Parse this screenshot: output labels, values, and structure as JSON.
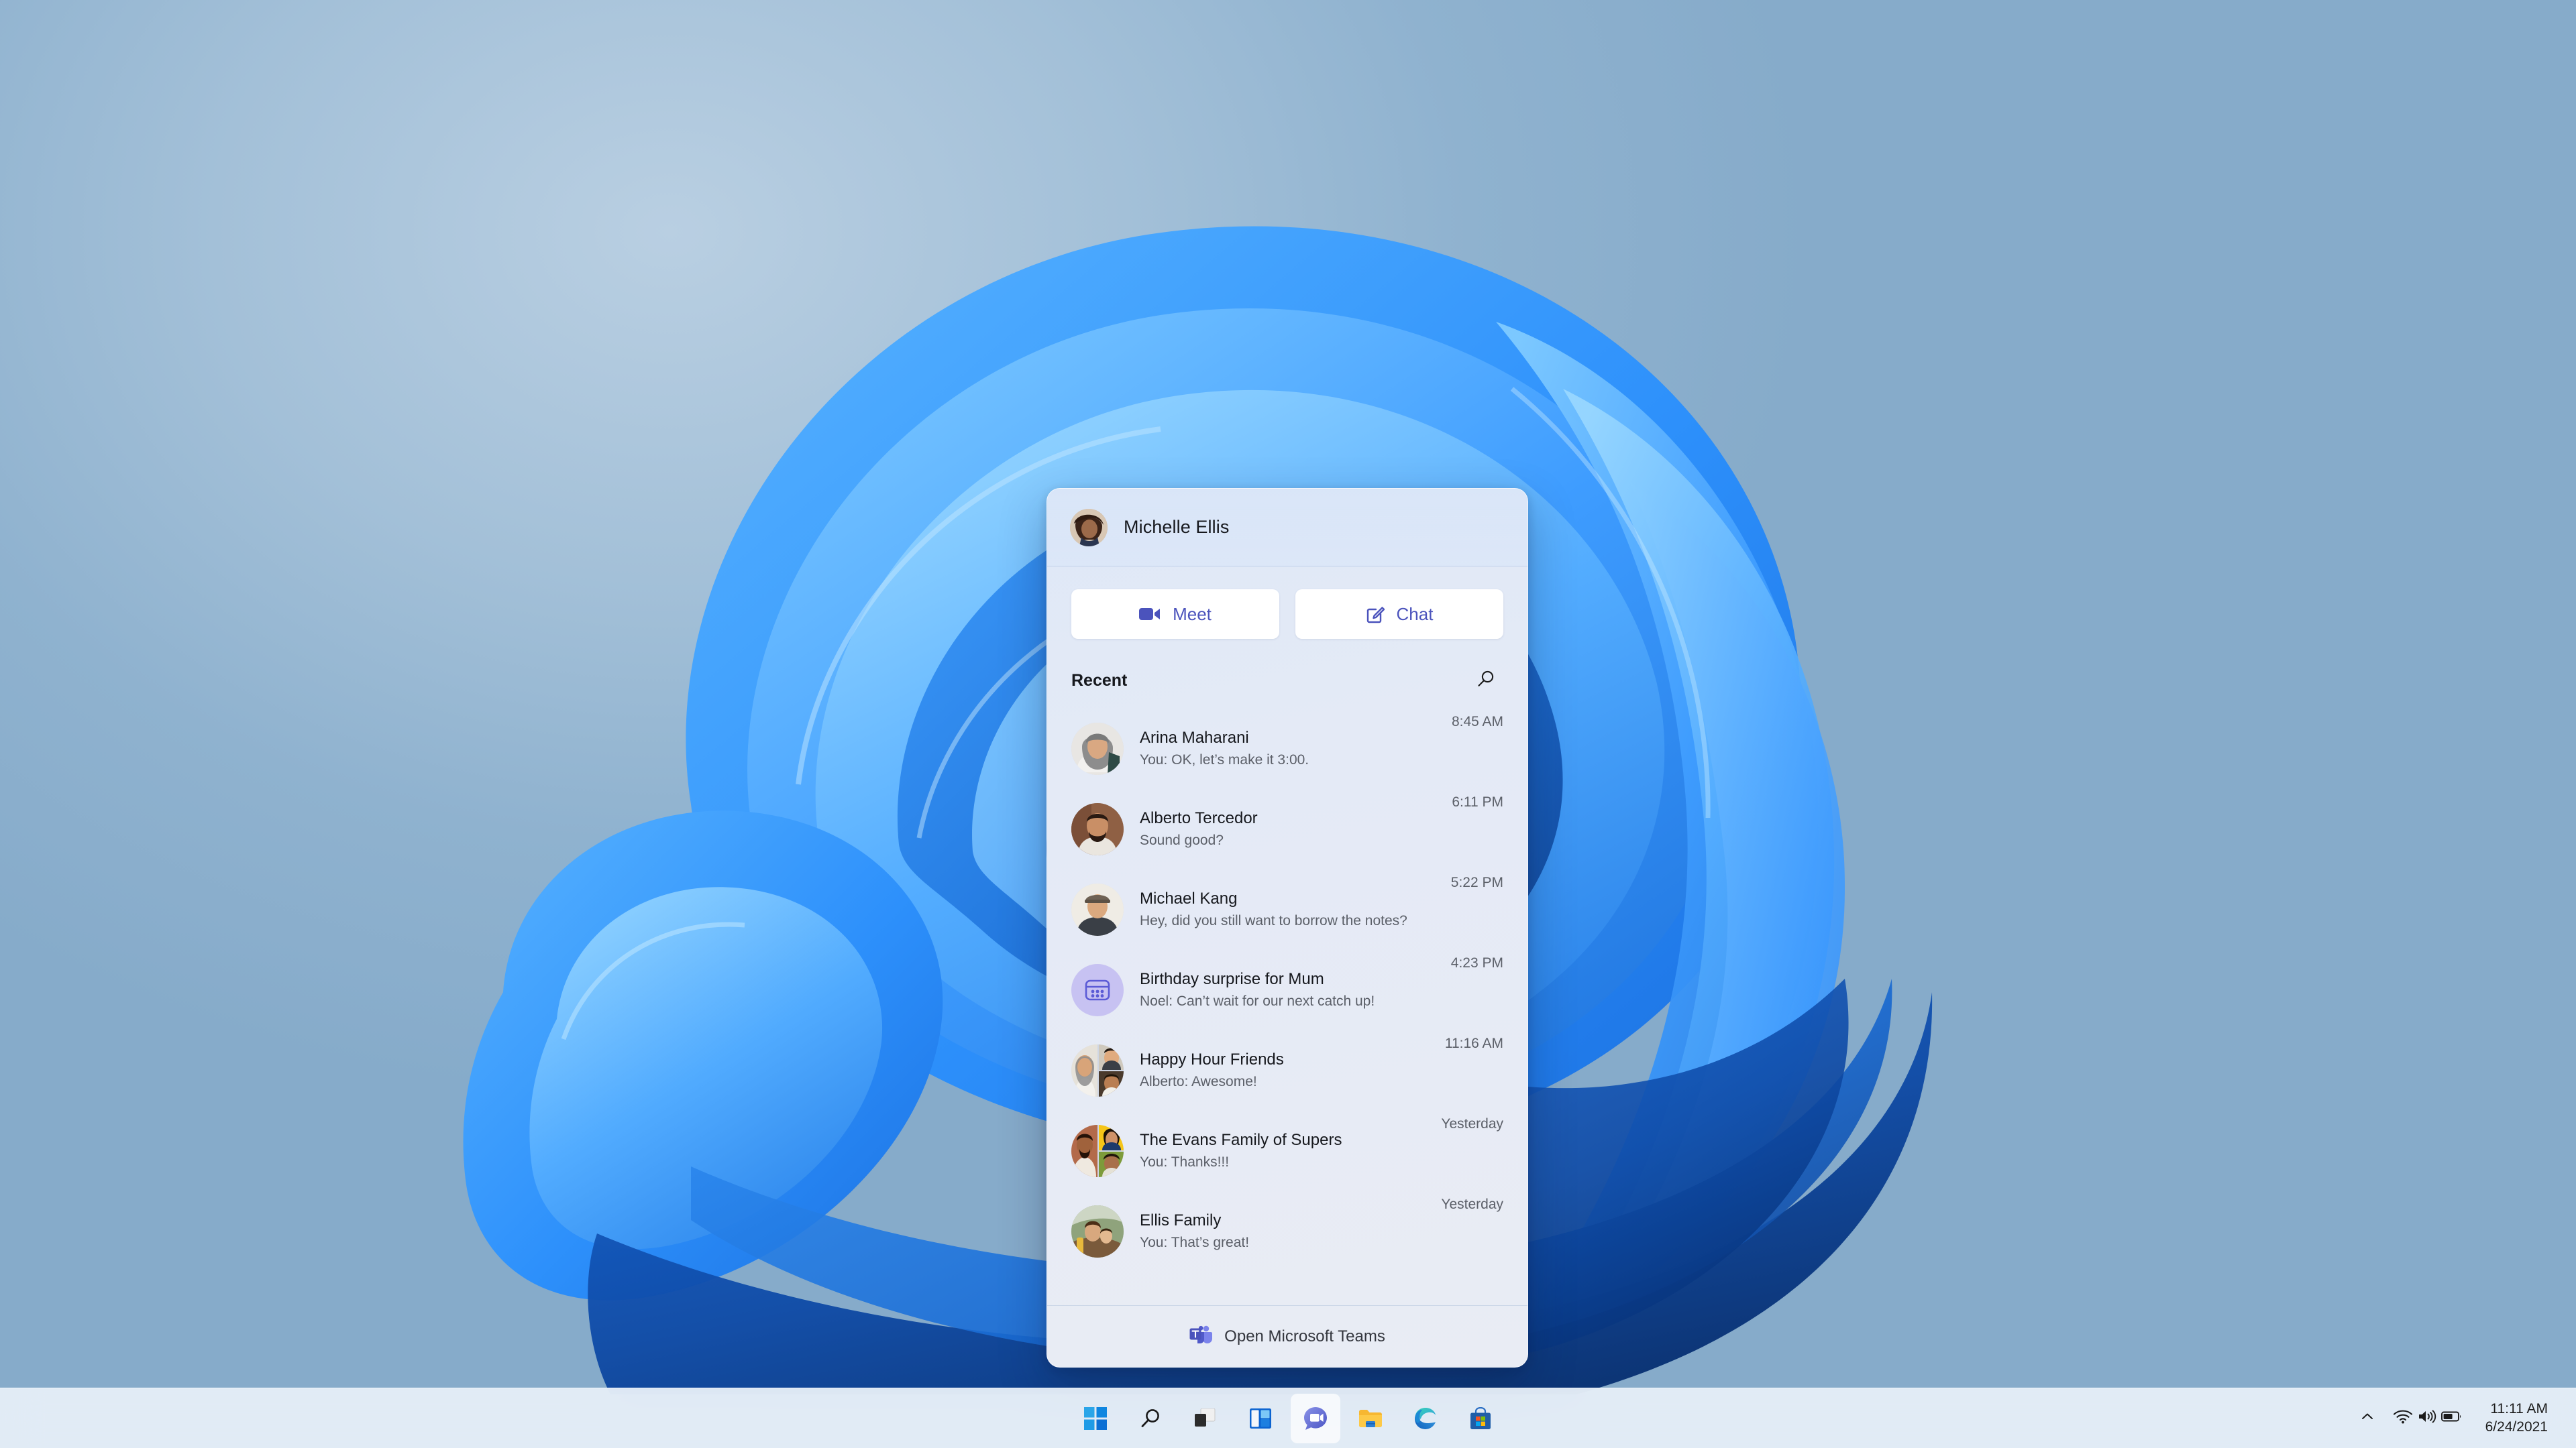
{
  "desktop": {
    "wallpaper_name": "windows-11-bloom",
    "background_color": "#8bb0ce"
  },
  "flyout": {
    "account": {
      "name": "Michelle Ellis",
      "avatar": "michelle-ellis-avatar"
    },
    "actions": [
      {
        "label": "Meet",
        "icon": "video-camera-icon",
        "color": "#4b53bc"
      },
      {
        "label": "Chat",
        "icon": "compose-chat-icon",
        "color": "#4b53bc"
      }
    ],
    "recent": {
      "label": "Recent",
      "search_icon": "search-icon"
    },
    "chats": [
      {
        "title": "Arina Maharani",
        "preview": "You: OK, let’s make it 3:00.",
        "time": "8:45 AM",
        "avatar_kind": "photo",
        "avatar_name": "arina-maharani-avatar"
      },
      {
        "title": "Alberto Tercedor",
        "preview": "Sound good?",
        "time": "6:11 PM",
        "avatar_kind": "photo",
        "avatar_name": "alberto-tercedor-avatar"
      },
      {
        "title": "Michael Kang",
        "preview": "Hey, did you still want to borrow the notes?",
        "time": "5:22 PM",
        "avatar_kind": "photo",
        "avatar_name": "michael-kang-avatar"
      },
      {
        "title": "Birthday surprise for Mum",
        "preview": "Noel: Can’t wait for our next catch up!",
        "time": "4:23 PM",
        "avatar_kind": "icon",
        "avatar_name": "group-chat-icon"
      },
      {
        "title": "Happy Hour Friends",
        "preview": "Alberto: Awesome!",
        "time": "11:16 AM",
        "avatar_kind": "group",
        "avatar_name": "happy-hour-friends-avatar"
      },
      {
        "title": "The Evans Family of Supers",
        "preview": "You: Thanks!!!",
        "time": "Yesterday",
        "avatar_kind": "group",
        "avatar_name": "evans-family-avatar"
      },
      {
        "title": "Ellis Family",
        "preview": "You: That’s great!",
        "time": "Yesterday",
        "avatar_kind": "photo",
        "avatar_name": "ellis-family-avatar"
      }
    ],
    "footer": {
      "label": "Open Microsoft Teams",
      "icon": "microsoft-teams-logo"
    }
  },
  "taskbar": {
    "items": [
      {
        "name": "start-button",
        "icon": "windows-logo-icon",
        "active": false
      },
      {
        "name": "search-button",
        "icon": "search-icon",
        "active": false
      },
      {
        "name": "task-view-button",
        "icon": "task-view-icon",
        "active": false
      },
      {
        "name": "widgets-button",
        "icon": "widgets-icon",
        "active": false
      },
      {
        "name": "chat-teams-button",
        "icon": "teams-chat-icon",
        "active": true
      },
      {
        "name": "file-explorer-button",
        "icon": "file-explorer-icon",
        "active": false
      },
      {
        "name": "edge-button",
        "icon": "microsoft-edge-icon",
        "active": false
      },
      {
        "name": "microsoft-store-button",
        "icon": "microsoft-store-icon",
        "active": false
      }
    ],
    "tray": {
      "show_hidden_icons": "chevron-up-icon",
      "network": "wifi-icon",
      "volume": "speaker-icon",
      "battery": "battery-icon",
      "time": "11:11 AM",
      "date": "6/24/2021"
    }
  }
}
